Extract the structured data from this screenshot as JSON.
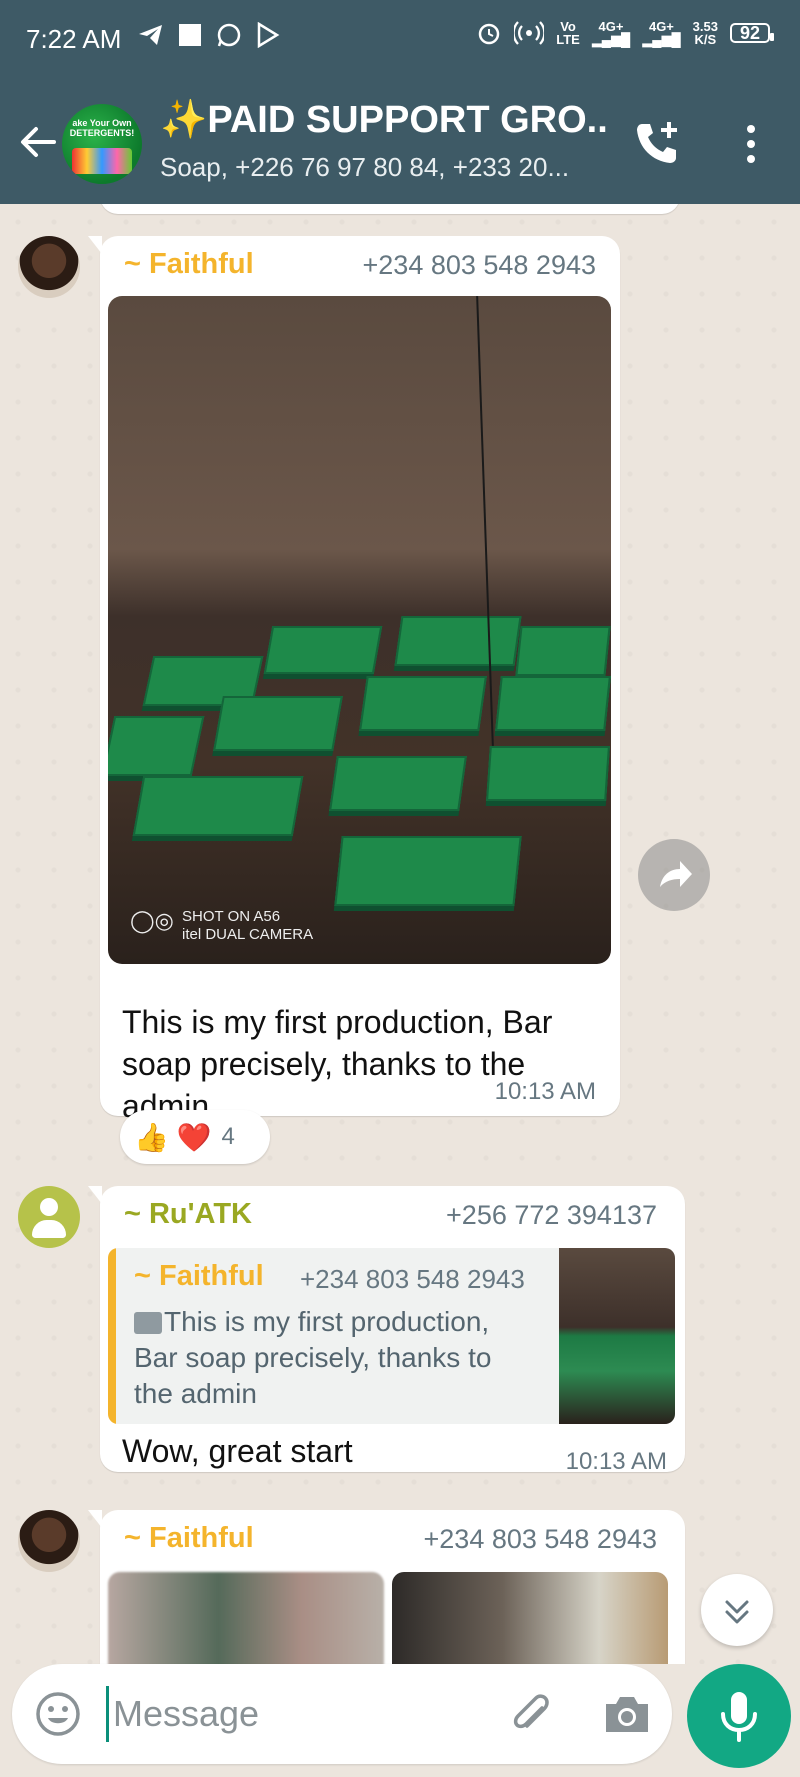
{
  "status": {
    "time": "7:22 AM",
    "volte_top": "Vo",
    "volte_bottom": "LTE",
    "net1": "4G+",
    "net2": "4G+",
    "speed_value": "3.53",
    "speed_unit": "K/S",
    "battery": "92"
  },
  "header": {
    "title": "✨PAID SUPPORT GRO...",
    "subtitle": "Soap, +226 76 97 80 84, +233 20...",
    "avatar_top_text": "ake Your Own",
    "avatar_main_text": "DETERGENTS!"
  },
  "messages": [
    {
      "sender": "~ Faithful",
      "phone": "+234 803 548 2943",
      "photo_watermark_line1": "SHOT ON A56",
      "photo_watermark_line2": "itel DUAL CAMERA",
      "text": "This is my first production, Bar soap precisely, thanks to the admin",
      "time": "10:13 AM",
      "reactions": {
        "emojis": "👍 ❤️",
        "count": "4"
      }
    },
    {
      "sender": "~ Ru'ATK",
      "phone": "+256 772 394137",
      "quote": {
        "sender": "~ Faithful",
        "phone": "+234 803 548 2943",
        "text": "This is my first production, Bar soap precisely, thanks to the admin"
      },
      "text": "Wow, great start",
      "time": "10:13 AM"
    },
    {
      "sender": "~ Faithful",
      "phone": "+234 803 548 2943"
    }
  ],
  "input": {
    "placeholder": "Message"
  },
  "colors": {
    "header_bg": "#3e5a66",
    "faithful_name": "#f4b42c",
    "ruatk_name": "#9aa822",
    "mic_button": "#12a884"
  }
}
